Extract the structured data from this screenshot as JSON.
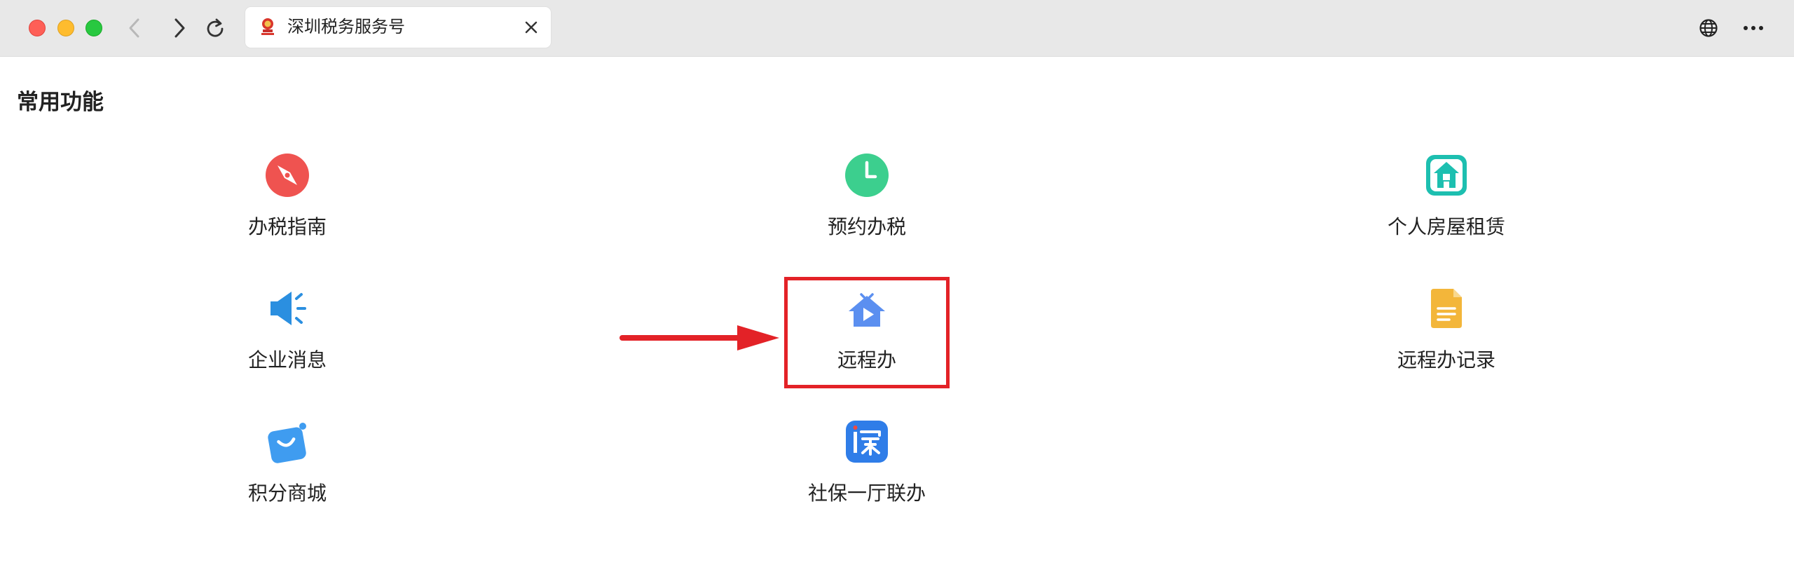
{
  "browser": {
    "tab_title": "深圳税务服务号",
    "icons": {
      "back": "chevron-left-icon",
      "forward": "chevron-right-icon",
      "reload": "reload-icon",
      "close": "close-icon",
      "globe": "globe-icon",
      "more": "more-icon"
    }
  },
  "page": {
    "section_title": "常用功能",
    "items": [
      {
        "label": "办税指南",
        "icon": "compass-icon",
        "color": "#ef5350"
      },
      {
        "label": "预约办税",
        "icon": "clock-icon",
        "color": "#3ccf8e"
      },
      {
        "label": "个人房屋租赁",
        "icon": "house-rent-icon",
        "color": "#1dbfb0"
      },
      {
        "label": "企业消息",
        "icon": "megaphone-icon",
        "color": "#2b8fe0"
      },
      {
        "label": "远程办",
        "icon": "remote-video-icon",
        "color": "#5b8ff0"
      },
      {
        "label": "远程办记录",
        "icon": "document-icon",
        "color": "#f3b63a"
      },
      {
        "label": "积分商城",
        "icon": "shopping-bag-icon",
        "color": "#3f9cf0"
      },
      {
        "label": "社保一厅联办",
        "icon": "shenzhen-app-icon",
        "color": "#2f7de8"
      }
    ]
  },
  "annotation": {
    "highlight_color": "#e32227"
  }
}
